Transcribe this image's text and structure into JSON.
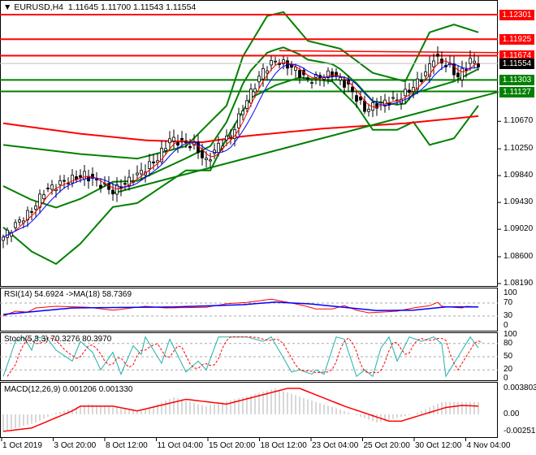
{
  "header": {
    "symbol": "EURUSD,H4",
    "ohlc": "1.11645 1.11700 1.11543 1.11554"
  },
  "chart_data": {
    "type": "candlestick",
    "symbol": "EURUSD",
    "timeframe": "H4",
    "bars": 118,
    "price_axis": [
      "1.10670",
      "1.10250",
      "1.09840",
      "1.09430",
      "1.09020",
      "1.08600",
      "1.08190"
    ],
    "price_range": [
      1.0819,
      1.12301
    ],
    "date_labels": [
      "1 Oct 2019",
      "3 Oct 20:00",
      "8 Oct 12:00",
      "11 Oct 04:00",
      "15 Oct 20:00",
      "18 Oct 12:00",
      "23 Oct 04:00",
      "25 Oct 20:00",
      "30 Oct 12:00",
      "4 Nov 04:00"
    ],
    "close_keypoints": [
      [
        0,
        1.089
      ],
      [
        4,
        1.0915
      ],
      [
        7,
        1.093
      ],
      [
        10,
        1.096
      ],
      [
        15,
        1.0975
      ],
      [
        20,
        1.0985
      ],
      [
        27,
        1.096
      ],
      [
        33,
        1.0985
      ],
      [
        38,
        1.101
      ],
      [
        41,
        1.104
      ],
      [
        47,
        1.103
      ],
      [
        50,
        1.1005
      ],
      [
        53,
        1.103
      ],
      [
        56,
        1.1045
      ],
      [
        60,
        1.11
      ],
      [
        64,
        1.1145
      ],
      [
        67,
        1.116
      ],
      [
        71,
        1.115
      ],
      [
        75,
        1.113
      ],
      [
        81,
        1.114
      ],
      [
        85,
        1.112
      ],
      [
        89,
        1.1085
      ],
      [
        93,
        1.1095
      ],
      [
        97,
        1.11
      ],
      [
        101,
        1.112
      ],
      [
        104,
        1.114
      ],
      [
        106,
        1.1165
      ],
      [
        110,
        1.115
      ],
      [
        112,
        1.1135
      ],
      [
        115,
        1.116
      ],
      [
        117,
        1.11554
      ]
    ],
    "bollinger_upper": [
      [
        0,
        1.1031
      ],
      [
        19,
        1.1017
      ],
      [
        33,
        1.101
      ],
      [
        45,
        1.1029
      ],
      [
        55,
        1.1091
      ],
      [
        59,
        1.1166
      ],
      [
        65,
        1.1228
      ],
      [
        69,
        1.1234
      ],
      [
        75,
        1.119
      ],
      [
        83,
        1.1178
      ],
      [
        91,
        1.1141
      ],
      [
        99,
        1.1128
      ],
      [
        105,
        1.1203
      ],
      [
        111,
        1.1215
      ],
      [
        117,
        1.1203
      ]
    ],
    "bollinger_lower": [
      [
        0,
        1.0905
      ],
      [
        7,
        1.0868
      ],
      [
        13,
        1.0849
      ],
      [
        19,
        1.088
      ],
      [
        27,
        1.0936
      ],
      [
        33,
        1.0942
      ],
      [
        45,
        1.0992
      ],
      [
        51,
        1.0992
      ],
      [
        55,
        1.1041
      ],
      [
        61,
        1.1103
      ],
      [
        67,
        1.1122
      ],
      [
        73,
        1.1134
      ],
      [
        81,
        1.1128
      ],
      [
        87,
        1.1091
      ],
      [
        91,
        1.1054
      ],
      [
        97,
        1.1054
      ],
      [
        101,
        1.1066
      ],
      [
        105,
        1.1031
      ],
      [
        111,
        1.1041
      ],
      [
        117,
        1.1091
      ]
    ],
    "slow_ma": [
      [
        0,
        1.1064
      ],
      [
        19,
        1.1048
      ],
      [
        35,
        1.1038
      ],
      [
        49,
        1.1035
      ],
      [
        59,
        1.1044
      ],
      [
        79,
        1.1056
      ],
      [
        99,
        1.1064
      ],
      [
        117,
        1.1075
      ]
    ],
    "trendline": [
      [
        27,
        1.0957
      ],
      [
        122,
        1.1112
      ]
    ],
    "resistance_segment": [
      [
        68,
        1.1175
      ],
      [
        122,
        1.1172
      ]
    ],
    "levels": [
      {
        "price": "1.12301",
        "color": "#ff0000"
      },
      {
        "price": "1.11925",
        "color": "#ff0000"
      },
      {
        "price": "1.11674",
        "color": "#ff0000"
      },
      {
        "price": "1.11554",
        "color": "#000000"
      },
      {
        "price": "1.11303",
        "color": "#008000"
      },
      {
        "price": "1.11127",
        "color": "#008000"
      }
    ],
    "rsi": {
      "label": "RSI(14) 54.6924  ->MA(18) 58.7369",
      "axis": [
        "100",
        "70",
        "30",
        "0"
      ],
      "values": [
        [
          0,
          30
        ],
        [
          3,
          45
        ],
        [
          6,
          42
        ],
        [
          8,
          55
        ],
        [
          13,
          60
        ],
        [
          21,
          57
        ],
        [
          27,
          48
        ],
        [
          35,
          60
        ],
        [
          40,
          55
        ],
        [
          50,
          57
        ],
        [
          55,
          68
        ],
        [
          60,
          72
        ],
        [
          66,
          82
        ],
        [
          71,
          70
        ],
        [
          74,
          62
        ],
        [
          77,
          52
        ],
        [
          81,
          52
        ],
        [
          84,
          62
        ],
        [
          87,
          48
        ],
        [
          90,
          40
        ],
        [
          97,
          45
        ],
        [
          101,
          55
        ],
        [
          105,
          62
        ],
        [
          107,
          72
        ],
        [
          108,
          60
        ],
        [
          113,
          55
        ],
        [
          114,
          60
        ],
        [
          117,
          58
        ]
      ],
      "ma": [
        [
          0,
          35
        ],
        [
          17,
          55
        ],
        [
          42,
          58
        ],
        [
          59,
          65
        ],
        [
          67,
          73
        ],
        [
          76,
          67
        ],
        [
          84,
          57
        ],
        [
          92,
          47
        ],
        [
          101,
          48
        ],
        [
          109,
          58
        ],
        [
          117,
          58
        ]
      ]
    },
    "stoch": {
      "label": "Stoch(5,3,3) 70.3276 80.3970",
      "axis": [
        "100",
        "80",
        "50",
        "20",
        "0"
      ],
      "main": [
        [
          0,
          5
        ],
        [
          3,
          85
        ],
        [
          5,
          95
        ],
        [
          7,
          65
        ],
        [
          8,
          95
        ],
        [
          11,
          90
        ],
        [
          13,
          65
        ],
        [
          17,
          40
        ],
        [
          19,
          85
        ],
        [
          22,
          60
        ],
        [
          24,
          20
        ],
        [
          27,
          60
        ],
        [
          29,
          10
        ],
        [
          32,
          75
        ],
        [
          34,
          55
        ],
        [
          35,
          95
        ],
        [
          39,
          35
        ],
        [
          41,
          90
        ],
        [
          45,
          15
        ],
        [
          48,
          40
        ],
        [
          50,
          20
        ],
        [
          53,
          95
        ],
        [
          57,
          95
        ],
        [
          60,
          95
        ],
        [
          64,
          85
        ],
        [
          66,
          95
        ],
        [
          71,
          15
        ],
        [
          73,
          20
        ],
        [
          76,
          10
        ],
        [
          77,
          20
        ],
        [
          79,
          10
        ],
        [
          82,
          95
        ],
        [
          84,
          90
        ],
        [
          87,
          5
        ],
        [
          89,
          20
        ],
        [
          91,
          5
        ],
        [
          93,
          70
        ],
        [
          95,
          95
        ],
        [
          97,
          40
        ],
        [
          100,
          95
        ],
        [
          103,
          85
        ],
        [
          106,
          95
        ],
        [
          108,
          80
        ],
        [
          109,
          5
        ],
        [
          112,
          50
        ],
        [
          115,
          95
        ],
        [
          117,
          70
        ]
      ]
    },
    "macd": {
      "label": "MACD(12,26,9) 0.001206 0.001330",
      "axis": [
        "0.003803",
        "0.00",
        "-0.00251"
      ],
      "range": [
        -0.00251,
        0.003803
      ],
      "histogram": [
        [
          0,
          -0.0025
        ],
        [
          8,
          -0.0012
        ],
        [
          13,
          0.0002
        ],
        [
          21,
          0.0015
        ],
        [
          27,
          0.001
        ],
        [
          34,
          0.0005
        ],
        [
          42,
          0.0025
        ],
        [
          50,
          0.0012
        ],
        [
          59,
          0.0025
        ],
        [
          67,
          0.0038
        ],
        [
          76,
          0.002
        ],
        [
          84,
          0.0005
        ],
        [
          92,
          -0.0012
        ],
        [
          101,
          0
        ],
        [
          108,
          0.0018
        ],
        [
          117,
          0.0018
        ]
      ],
      "signal": [
        [
          0,
          -0.0025
        ],
        [
          7,
          -0.002
        ],
        [
          17,
          0.0005
        ],
        [
          19,
          0.0012
        ],
        [
          27,
          0.0012
        ],
        [
          33,
          0.0005
        ],
        [
          45,
          0.0022
        ],
        [
          55,
          0.0015
        ],
        [
          70,
          0.0038
        ],
        [
          73,
          0.0038
        ],
        [
          84,
          0.0012
        ],
        [
          95,
          -0.001
        ],
        [
          98,
          -0.001
        ],
        [
          109,
          0.001
        ],
        [
          113,
          0.0013
        ],
        [
          117,
          0.0012
        ]
      ]
    }
  }
}
